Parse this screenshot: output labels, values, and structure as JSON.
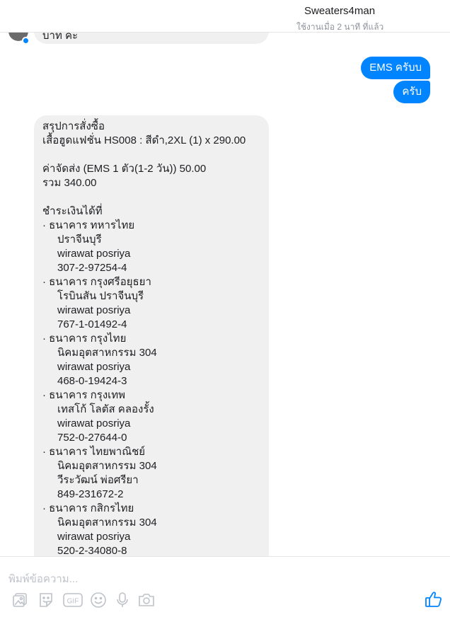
{
  "header": {
    "title": "Sweaters4man",
    "status": "ใช้งานเมื่อ 2 นาที ที่แล้ว"
  },
  "messages": {
    "incoming_top": "บาท ค่ะ",
    "outgoing": [
      "EMS ครับบ",
      "ครับ"
    ]
  },
  "order_summary": {
    "heading": "สรุปการสั่งซื้อ",
    "item": "เสื้อฮูดแฟชั่น HS008 : สีดำ,2XL (1) x 290.00",
    "shipping": "ค่าจัดส่ง (EMS 1 ตัว(1-2 วัน)) 50.00",
    "total": "รวม 340.00",
    "pay_heading": "ชำระเงินได้ที่",
    "banks": [
      {
        "name": "· ธนาคาร ทหารไทย",
        "branch": "ปราจีนบุรี",
        "holder": "wirawat posriya",
        "account": "307-2-97254-4"
      },
      {
        "name": "· ธนาคาร กรุงศรีอยุธยา",
        "branch": "โรบินสัน ปราจีนบุรี",
        "holder": "wirawat posriya",
        "account": "767-1-01492-4"
      },
      {
        "name": "· ธนาคาร กรุงไทย",
        "branch": "นิคมอุตสาหกรรม 304",
        "holder": "wirawat posriya",
        "account": "468-0-19424-3"
      },
      {
        "name": "· ธนาคาร กรุงเทพ",
        "branch": "เทสโก้ โลตัส คลองรั้ง",
        "holder": "wirawat posriya",
        "account": "752-0-27644-0"
      },
      {
        "name": "· ธนาคาร ไทยพาณิชย์",
        "branch": "นิคมอุตสาหกรรม 304",
        "holder": "วีระวัฒน์ พ่อศรียา",
        "account": "849-231672-2"
      },
      {
        "name": "· ธนาคาร กสิกรไทย",
        "branch": "นิคมอุตสาหกรรม 304",
        "holder": "wirawat posriya",
        "account": "520-2-34080-8"
      }
    ]
  },
  "composer": {
    "placeholder": "พิมพ์ข้อความ...",
    "gif_label": "GIF",
    "icons": [
      "photo-icon",
      "sticker-icon",
      "gif-icon",
      "emoji-icon",
      "microphone-icon",
      "camera-icon",
      "like-icon"
    ]
  },
  "colors": {
    "accent": "#0084ff",
    "bubble_incoming": "#f1f0f0",
    "muted": "#90949c",
    "icon_gray": "#bec3c9"
  }
}
